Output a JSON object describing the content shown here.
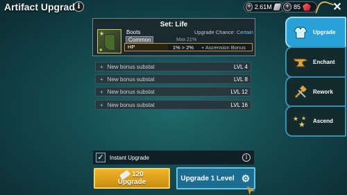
{
  "header": {
    "title": "Artifact Upgrade",
    "info_icon": "info-icon",
    "silver": "2.61M",
    "gems": "85",
    "close_icon": "close-icon"
  },
  "artifact": {
    "set_title": "Set: Life",
    "name": "Boots",
    "rarity": "Common",
    "upgrade_chance_label": "Upgrade Chance:",
    "upgrade_chance_value": "Certain",
    "max_chance": "Max 21%",
    "main_stat": {
      "name": "HP",
      "value": "1% > 2%",
      "ascension": "+ Ascension Bonus"
    }
  },
  "substats": [
    {
      "label": "New bonus substat",
      "level": "LVL 4"
    },
    {
      "label": "New bonus substat",
      "level": "LVL 8"
    },
    {
      "label": "New bonus substat",
      "level": "LVL 12"
    },
    {
      "label": "New bonus substat",
      "level": "LVL 16"
    }
  ],
  "side_menu": [
    {
      "label": "Upgrade",
      "icon": "armor-icon",
      "active": true
    },
    {
      "label": "Enchant",
      "icon": "anvil-icon",
      "active": false
    },
    {
      "label": "Rework",
      "icon": "hammer-icon",
      "active": false
    },
    {
      "label": "Ascend",
      "icon": "star-cluster-icon",
      "active": false
    }
  ],
  "instant_upgrade": {
    "label": "Instant Upgrade",
    "checked": true
  },
  "buttons": {
    "upgrade_cost": "120",
    "upgrade_label": "Upgrade",
    "upgrade_one_level": "Upgrade 1 Level"
  },
  "colors": {
    "accent": "#2aa0d8",
    "gold": "#f0b428",
    "chance": "#6fc7ea"
  }
}
